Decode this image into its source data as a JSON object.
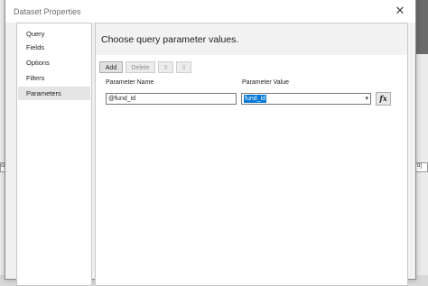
{
  "window": {
    "title": "Dataset Properties",
    "close_glyph": "✕"
  },
  "sidebar": {
    "items": [
      {
        "label": "Query"
      },
      {
        "label": "Fields"
      },
      {
        "label": "Options"
      },
      {
        "label": "Filters"
      },
      {
        "label": "Parameters"
      }
    ],
    "selected": "Parameters"
  },
  "content": {
    "heading": "Choose query parameter values.",
    "toolbar": {
      "add_label": "Add",
      "delete_label": "Delete",
      "up_icon": "⇧",
      "down_icon": "⇩"
    },
    "columns": {
      "name": "Parameter Name",
      "value": "Parameter Value"
    },
    "row": {
      "name": "@fund_id",
      "value": "fund_id",
      "fx_label": "fx"
    }
  },
  "background": {
    "left_fragment": "city]",
    "right_fragment": "rd]"
  },
  "colors": {
    "selection": "#0078d7",
    "selected_nav": "#e5e5e5"
  }
}
